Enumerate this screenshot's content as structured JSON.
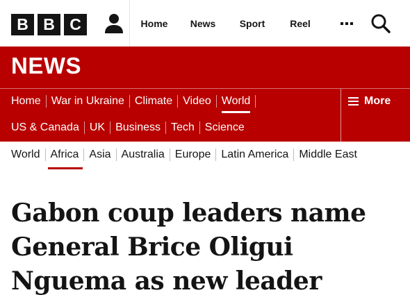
{
  "header": {
    "logo_letters": [
      "B",
      "B",
      "C"
    ],
    "nav": [
      "Home",
      "News",
      "Sport",
      "Reel"
    ],
    "account_icon": "person-icon",
    "more_icon": "ellipsis-icon",
    "search_icon": "search-icon"
  },
  "masthead": {
    "wordmark": "NEWS",
    "primary_nav": [
      {
        "label": "Home",
        "active": false
      },
      {
        "label": "War in Ukraine",
        "active": false
      },
      {
        "label": "Climate",
        "active": false
      },
      {
        "label": "Video",
        "active": false
      },
      {
        "label": "World",
        "active": true
      }
    ],
    "secondary_nav": [
      {
        "label": "US & Canada"
      },
      {
        "label": "UK"
      },
      {
        "label": "Business"
      },
      {
        "label": "Tech"
      },
      {
        "label": "Science"
      }
    ],
    "more_label": "More",
    "more_icon": "hamburger-icon"
  },
  "subnav": [
    {
      "label": "World",
      "active": false
    },
    {
      "label": "Africa",
      "active": true
    },
    {
      "label": "Asia",
      "active": false
    },
    {
      "label": "Australia",
      "active": false
    },
    {
      "label": "Europe",
      "active": false
    },
    {
      "label": "Latin America",
      "active": false
    },
    {
      "label": "Middle East",
      "active": false
    }
  ],
  "article": {
    "headline_lines": [
      "Gabon coup leaders name",
      "General Brice Oligui",
      "Nguema as new leader"
    ]
  },
  "colors": {
    "brand_red": "#b80000",
    "text_dark": "#141414"
  }
}
